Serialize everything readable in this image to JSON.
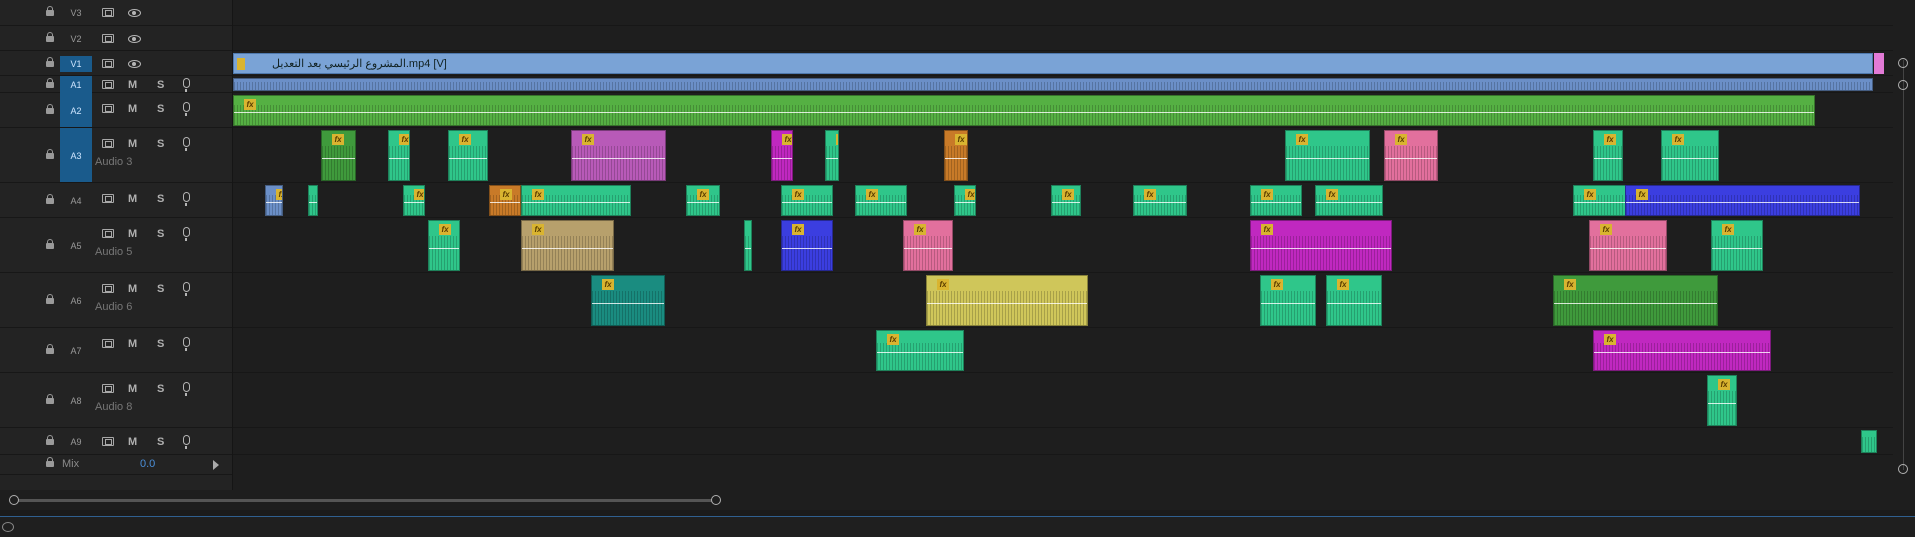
{
  "tracks": [
    {
      "id": "V3",
      "type": "video",
      "target": false,
      "name": ""
    },
    {
      "id": "V2",
      "type": "video",
      "target": false,
      "name": ""
    },
    {
      "id": "V1",
      "type": "video",
      "target": true,
      "name": ""
    },
    {
      "id": "A1",
      "type": "audio",
      "target": true,
      "name": ""
    },
    {
      "id": "A2",
      "type": "audio",
      "target": true,
      "name": ""
    },
    {
      "id": "A3",
      "type": "audio",
      "target": true,
      "name": "Audio 3"
    },
    {
      "id": "A4",
      "type": "audio",
      "target": false,
      "name": ""
    },
    {
      "id": "A5",
      "type": "audio",
      "target": false,
      "name": "Audio 5"
    },
    {
      "id": "A6",
      "type": "audio",
      "target": false,
      "name": "Audio 6"
    },
    {
      "id": "A7",
      "type": "audio",
      "target": false,
      "name": ""
    },
    {
      "id": "A8",
      "type": "audio",
      "target": false,
      "name": "Audio 8"
    },
    {
      "id": "A9",
      "type": "audio",
      "target": false,
      "name": ""
    }
  ],
  "buttons": {
    "mute": "M",
    "solo": "S"
  },
  "mix": {
    "label": "Mix",
    "value": "0.0"
  },
  "v1_clip": {
    "label": "المشروع الرئيسي بعد التعديل.mp4 [V]"
  },
  "colors": {
    "video": "#7aa3d6",
    "green": "#2fc68a",
    "a1": "#6b8fc7",
    "a2": "#55b043",
    "purple": "#b85ab8",
    "pink": "#e2709d",
    "orange": "#c87a28",
    "blue": "#3b3ee0",
    "tan": "#b7a06c",
    "teal": "#1a8c80",
    "yellow": "#cfc65a",
    "magenta": "#c028c0",
    "darkgreen": "#3f9a3c"
  },
  "fx_label": "fx"
}
